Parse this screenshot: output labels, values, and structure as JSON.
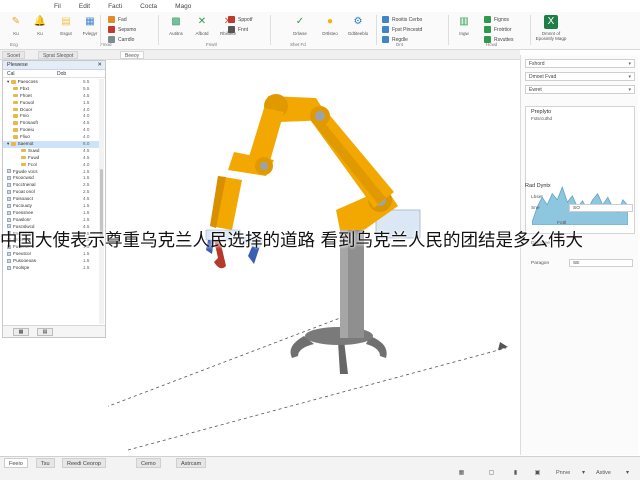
{
  "menu": [
    "Fil",
    "Edit",
    "Facti",
    "Cocta",
    "Mago"
  ],
  "ribbon": {
    "big": [
      {
        "label": "Ku",
        "icon": "wrench-icon",
        "color": "#e8a33c",
        "glyph": "✎"
      },
      {
        "label": "Ku",
        "icon": "bell-icon",
        "color": "#5a6f8a",
        "glyph": "🔔"
      },
      {
        "label": "Esgut",
        "icon": "folder-icon",
        "color": "#f0c24d",
        "glyph": "▤"
      },
      {
        "label": "Fvlegyr",
        "icon": "document-icon",
        "color": "#3f86c9",
        "glyph": "▦"
      },
      {
        "label": "Autitns",
        "icon": "grid-icon",
        "color": "#2f9a67",
        "glyph": "▩"
      },
      {
        "label": "Afbotd",
        "icon": "close-icon",
        "color": "#2e9a4f",
        "glyph": "✕"
      },
      {
        "label": "Rbilliete",
        "icon": "close-red-icon",
        "color": "#d9534f",
        "glyph": "✕"
      },
      {
        "label": "Drlwse",
        "icon": "check-icon",
        "color": "#2e9a4f",
        "glyph": "✓"
      },
      {
        "label": "Drtlsteo",
        "icon": "bulb-icon",
        "color": "#f2b500",
        "glyph": "●"
      },
      {
        "label": "Gdtiteeblo",
        "icon": "gear-icon",
        "color": "#2f7fc1",
        "glyph": "⚙"
      },
      {
        "label": "Ingw",
        "icon": "chart-icon",
        "color": "#2e9a4f",
        "glyph": "▥"
      },
      {
        "label": "Dmnnt of Eposintly Magp",
        "icon": "excel-icon",
        "color": "#1e7e45",
        "glyph": "X"
      }
    ],
    "small": [
      {
        "label": "Fad",
        "icon": "scissors-icon",
        "color": "#e28b2c"
      },
      {
        "label": "Sepsmo",
        "icon": "copy-icon",
        "color": "#c0392b"
      },
      {
        "label": "Carrdlo",
        "icon": "paste-icon",
        "color": "#7f8c8d"
      },
      {
        "label": "Sppotf",
        "icon": "format-icon",
        "color": "#c0392b"
      },
      {
        "label": "Fnnt",
        "icon": "font-icon",
        "color": "#555555"
      },
      {
        "label": "Rooitis Cerbo",
        "icon": "table-icon",
        "color": "#3f86c9"
      },
      {
        "label": "Fpst Pincestd",
        "icon": "filter-icon",
        "color": "#3f86c9"
      },
      {
        "label": "Regdle",
        "icon": "sort-icon",
        "color": "#3f86c9"
      },
      {
        "label": "Fignos",
        "icon": "figure-icon",
        "color": "#2e9a4f"
      },
      {
        "label": "Frotrtior",
        "icon": "flow-icon",
        "color": "#2e9a4f"
      },
      {
        "label": "Rsvuttes",
        "icon": "list-icon",
        "color": "#2e9a4f"
      }
    ],
    "groups": [
      "Ecg",
      "Fmod",
      "Fnwtl",
      "Shet Fd",
      "Dnt",
      "Hcwd"
    ]
  },
  "doc_tabs": [
    "Sooet",
    "Sprat Sleopot",
    "Beeoy"
  ],
  "left_panel": {
    "title": "Plewese",
    "columns": [
      "Cal",
      "Dob"
    ],
    "tree": [
      {
        "label": "Paeocoss",
        "value": "5.5",
        "type": "root"
      },
      {
        "label": "Fbxt",
        "value": "5.5",
        "type": "folder"
      },
      {
        "label": "Fhoet",
        "value": "4.5",
        "type": "folder"
      },
      {
        "label": "Fuouol",
        "value": "1.5",
        "type": "folder"
      },
      {
        "label": "Dcuor",
        "value": "4.0",
        "type": "folder"
      },
      {
        "label": "Fnio",
        "value": "4.0",
        "type": "folder"
      },
      {
        "label": "Fnosaoft",
        "value": "4.5",
        "type": "folder"
      },
      {
        "label": "Fooeiu",
        "value": "4.0",
        "type": "folder"
      },
      {
        "label": "Fliuo",
        "value": "4.0",
        "type": "folder"
      },
      {
        "label": "Saemot",
        "value": "6.0",
        "type": "sel"
      },
      {
        "label": "Suwd",
        "value": "4.5",
        "type": "sub"
      },
      {
        "label": "Fuwd",
        "value": "4.5",
        "type": "sub"
      },
      {
        "label": "Fcol",
        "value": "4.0",
        "type": "sub"
      },
      {
        "label": "Fgwde vocs",
        "value": "1.5",
        "type": "leaf"
      },
      {
        "label": "Fsoocwsd",
        "value": "1.5",
        "type": "leaf"
      },
      {
        "label": "Focctnenal",
        "value": "2.5",
        "type": "leaf"
      },
      {
        "label": "Fuoat onol",
        "value": "2.5",
        "type": "leaf"
      },
      {
        "label": "Foisoaoct",
        "value": "4.5",
        "type": "leaf"
      },
      {
        "label": "Fucouuty",
        "value": "1.5",
        "type": "leaf"
      },
      {
        "label": "Foessnee",
        "value": "1.5",
        "type": "leaf"
      },
      {
        "label": "Foaslonr",
        "value": "1.5",
        "type": "leaf"
      },
      {
        "label": "Fuscslwcd",
        "value": "4.5",
        "type": "leaf"
      },
      {
        "label": "Foeottuid",
        "value": "1.5",
        "type": "leaf"
      },
      {
        "label": "Frotsoen",
        "value": "1.5",
        "type": "leaf"
      },
      {
        "label": "Fuoteoe",
        "value": "1.5",
        "type": "leaf"
      },
      {
        "label": "Foeutcor",
        "value": "1.5",
        "type": "leaf"
      },
      {
        "label": "Pusooeoas",
        "value": "1.5",
        "type": "leaf"
      },
      {
        "label": "Foolspe",
        "value": "1.5",
        "type": "leaf"
      }
    ]
  },
  "right_panel": {
    "dropdowns": [
      "Fshord",
      "Dmoet Fvad",
      "Ewret"
    ],
    "properties_title": "Preplyto",
    "properties_sub": "Fstsrcuthd",
    "section": "Rad Dyntx",
    "fields": [
      {
        "label": "Lbset",
        "value": ""
      },
      {
        "label": "Sne",
        "value": "SO"
      },
      {
        "label": "Fottl",
        "value": ""
      },
      {
        "label": "Dluostee",
        "value": ""
      },
      {
        "label": "Paragon",
        "value": "SE"
      }
    ],
    "chart_series": [
      0.05,
      0.35,
      0.55,
      0.4,
      0.62,
      0.5,
      0.75,
      0.45,
      0.58,
      0.35,
      0.48,
      0.3,
      0.5,
      0.62,
      0.4,
      0.55,
      0.35,
      0.25,
      0.5,
      0.38
    ]
  },
  "subtitle": "中国大使表示尊重乌克兰人民选择的道路 看到乌克兰人民的团结是多么伟大",
  "bottom_tabs": [
    "Feeio",
    "Tsu",
    "Reedi Ceorop",
    "Cemo",
    "Astrcam"
  ],
  "status": {
    "items": [
      "Pnrve",
      "Astive"
    ],
    "icons": [
      "grid-icon",
      "window-icon",
      "trash-icon",
      "lock-icon",
      "zoom-icon"
    ]
  },
  "colors": {
    "robot_arm": "#f2a800",
    "robot_arm_dark": "#c98600",
    "column": "#8c8c8c",
    "base": "#6d6d6d",
    "accent_blue": "#cfe0f5",
    "chart_fill": "#8fc6df"
  }
}
